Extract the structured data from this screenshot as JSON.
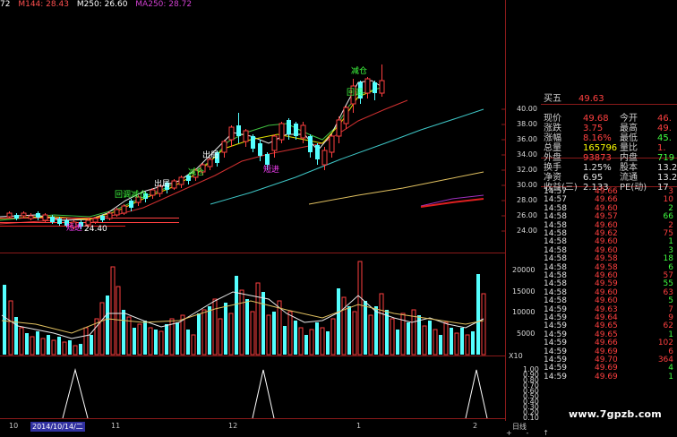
{
  "ma_legend": [
    {
      "label": "72",
      "color": "#ffffff"
    },
    {
      "label": "M144: 28.43",
      "color": "#ff5050"
    },
    {
      "label": "M250: 26.60",
      "color": "#ffffff"
    },
    {
      "label": "MA250: 28.72",
      "color": "#d040d0"
    }
  ],
  "price_axis": [
    "40.00",
    "38.00",
    "36.00",
    "34.00",
    "32.00",
    "30.00",
    "28.00",
    "26.00",
    "24.00"
  ],
  "volume_axis": [
    "20000",
    "15000",
    "10000",
    "5000"
  ],
  "volume_unit": "X10",
  "indicator_axis": [
    "1.00",
    "0.90",
    "0.80",
    "0.70",
    "0.60",
    "0.50",
    "0.40",
    "0.30",
    "0.20",
    "0.10"
  ],
  "annotations": [
    {
      "text": "减仓",
      "color": "#40ff40"
    },
    {
      "text": "回调",
      "color": "#40ff40"
    },
    {
      "text": "出局",
      "color": "#ffffff"
    },
    {
      "text": "出局",
      "color": "#ffffff"
    },
    {
      "text": "减仓",
      "color": "#40ff40"
    },
    {
      "text": "回调减仓",
      "color": "#40ff40"
    },
    {
      "text": "短进",
      "color": "#ff40ff"
    },
    {
      "text": "短进",
      "color": "#ff40ff"
    },
    {
      "text": "24.40",
      "color": "#ffffff"
    }
  ],
  "quote": {
    "sell5": {
      "label": "买五",
      "value": "49.63"
    },
    "rows": [
      {
        "l1": "现价",
        "v1": "49.68",
        "l2": "今开",
        "v2": "46.",
        "c1": "#ff4040",
        "c2": "#ff4040"
      },
      {
        "l1": "涨跌",
        "v1": "3.75",
        "l2": "最高",
        "v2": "49.",
        "c1": "#ff4040",
        "c2": "#ff4040"
      },
      {
        "l1": "涨幅",
        "v1": "8.16%",
        "l2": "最低",
        "v2": "45.",
        "c1": "#ff4040",
        "c2": "#40ff40"
      },
      {
        "l1": "总量",
        "v1": "165796",
        "l2": "量比",
        "v2": "1.",
        "c1": "#ffff00",
        "c2": "#ff4040"
      },
      {
        "l1": "外盘",
        "v1": "93873",
        "l2": "内盘",
        "v2": "719",
        "c1": "#ff4040",
        "c2": "#40ff40"
      },
      {
        "l1": "换手",
        "v1": "1.25%",
        "l2": "股本",
        "v2": "13.2",
        "c1": "#e0e0e0",
        "c2": "#e0e0e0"
      },
      {
        "l1": "净资",
        "v1": "6.95",
        "l2": "流通",
        "v2": "13.2",
        "c1": "#e0e0e0",
        "c2": "#e0e0e0"
      },
      {
        "l1": "收益(三)",
        "v1": "2.133",
        "l2": "PE(动)",
        "v2": "17",
        "c1": "#e0e0e0",
        "c2": "#e0e0e0"
      }
    ],
    "ticks": [
      {
        "t": "14:57",
        "p": "49.66",
        "v": "3",
        "vc": "#ff4040"
      },
      {
        "t": "14:57",
        "p": "49.66",
        "v": "10",
        "vc": "#ff4040"
      },
      {
        "t": "14:58",
        "p": "49.60",
        "v": "2",
        "vc": "#40ff40"
      },
      {
        "t": "14:58",
        "p": "49.57",
        "v": "66",
        "vc": "#40ff40"
      },
      {
        "t": "14:58",
        "p": "49.60",
        "v": "2",
        "vc": "#ff4040"
      },
      {
        "t": "14:58",
        "p": "49.62",
        "v": "75",
        "vc": "#ff4040"
      },
      {
        "t": "14:58",
        "p": "49.60",
        "v": "1",
        "vc": "#40ff40"
      },
      {
        "t": "14:58",
        "p": "49.60",
        "v": "3",
        "vc": "#40ff40"
      },
      {
        "t": "14:58",
        "p": "49.58",
        "v": "18",
        "vc": "#40ff40"
      },
      {
        "t": "14:58",
        "p": "49.58",
        "v": "6",
        "vc": "#40ff40"
      },
      {
        "t": "14:58",
        "p": "49.60",
        "v": "57",
        "vc": "#ff4040"
      },
      {
        "t": "14:58",
        "p": "49.59",
        "v": "55",
        "vc": "#40ff40"
      },
      {
        "t": "14:58",
        "p": "49.60",
        "v": "63",
        "vc": "#ff4040"
      },
      {
        "t": "14:58",
        "p": "49.60",
        "v": "5",
        "vc": "#40ff40"
      },
      {
        "t": "14:59",
        "p": "49.63",
        "v": "7",
        "vc": "#ff4040"
      },
      {
        "t": "14:59",
        "p": "49.64",
        "v": "9",
        "vc": "#ff4040"
      },
      {
        "t": "14:59",
        "p": "49.65",
        "v": "62",
        "vc": "#ff4040"
      },
      {
        "t": "14:59",
        "p": "49.65",
        "v": "1",
        "vc": "#40ff40"
      },
      {
        "t": "14:59",
        "p": "49.66",
        "v": "102",
        "vc": "#ff4040"
      },
      {
        "t": "14:59",
        "p": "49.69",
        "v": "6",
        "vc": "#ff4040"
      },
      {
        "t": "14:59",
        "p": "49.70",
        "v": "364",
        "vc": "#ff4040"
      },
      {
        "t": "14:59",
        "p": "49.69",
        "v": "4",
        "vc": "#40ff40"
      },
      {
        "t": "14:59",
        "p": "49.69",
        "v": "1",
        "vc": "#40ff40"
      }
    ]
  },
  "date_axis": [
    "10",
    "2014/10/14/二",
    "11",
    "12",
    "1",
    "2"
  ],
  "period_label": "日线",
  "bottom_controls": [
    "+",
    "-",
    "↑"
  ],
  "watermark": "www.7gpzb.com",
  "colors": {
    "up": "#ff4040",
    "down": "#54ffff",
    "ma5": "#ffffff",
    "ma10": "#ffff00",
    "ma20": "#ff4040",
    "ma60": "#40ff40",
    "grid": "#8a1a1a"
  }
}
